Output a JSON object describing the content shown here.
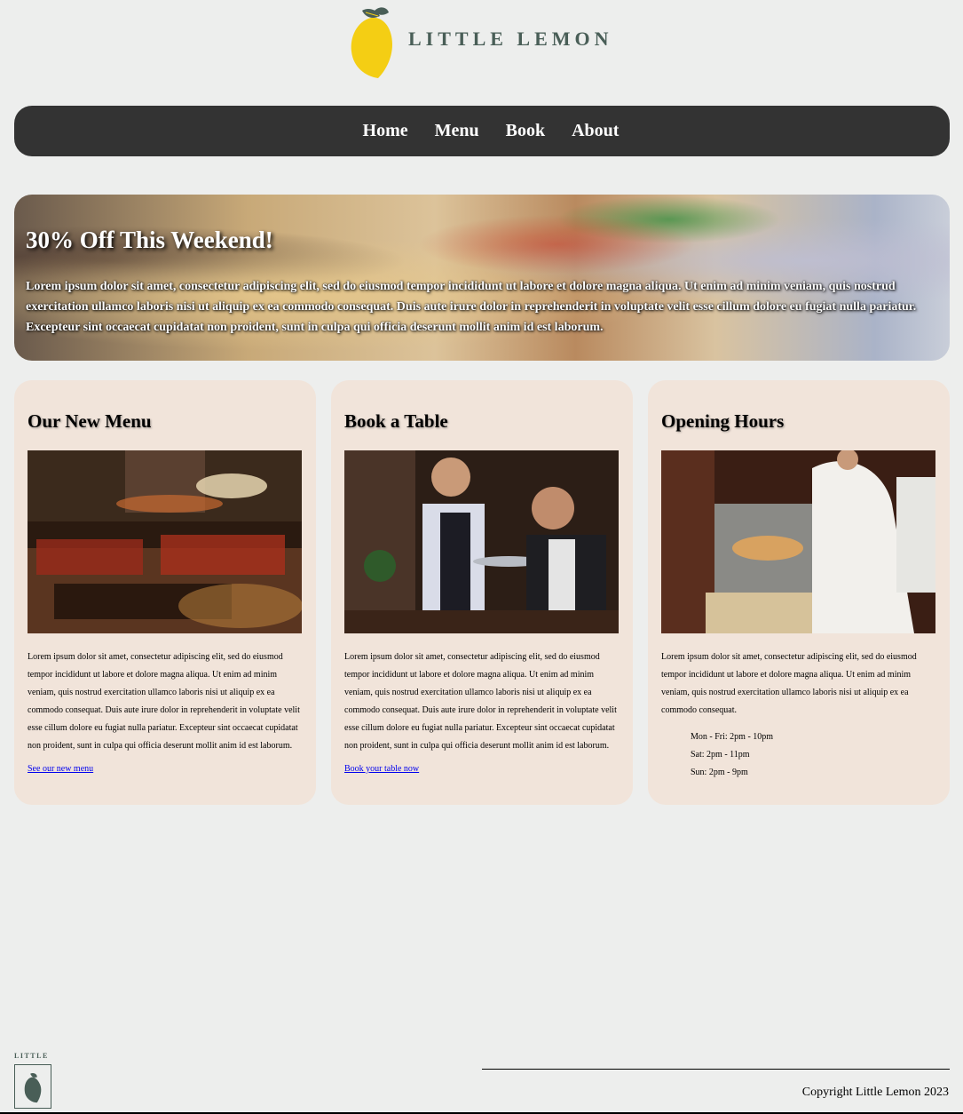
{
  "header": {
    "logo_text": "LITTLE LEMON",
    "logo_icon": "lemon-icon"
  },
  "nav": {
    "items": [
      {
        "label": "Home"
      },
      {
        "label": "Menu"
      },
      {
        "label": "Book"
      },
      {
        "label": "About"
      }
    ]
  },
  "promo": {
    "title": "30% Off This Weekend!",
    "text": "Lorem ipsum dolor sit amet, consectetur adipiscing elit, sed do eiusmod tempor incididunt ut labore et dolore magna aliqua. Ut enim ad minim veniam, quis nostrud exercitation ullamco laboris nisi ut aliquip ex ea commodo consequat. Duis aute irure dolor in reprehenderit in voluptate velit esse cillum dolore eu fugiat nulla pariatur. Excepteur sint occaecat cupidatat non proident, sunt in culpa qui officia deserunt mollit anim id est laborum."
  },
  "cards": [
    {
      "title": "Our New Menu",
      "text": "Lorem ipsum dolor sit amet, consectetur adipiscing elit, sed do eiusmod tempor incididunt ut labore et dolore magna aliqua. Ut enim ad minim veniam, quis nostrud exercitation ullamco laboris nisi ut aliquip ex ea commodo consequat. Duis aute irure dolor in reprehenderit in voluptate velit esse cillum dolore eu fugiat nulla pariatur. Excepteur sint occaecat cupidatat non proident, sunt in culpa qui officia deserunt mollit anim id est laborum.",
      "link": "See our new menu"
    },
    {
      "title": "Book a Table",
      "text": "Lorem ipsum dolor sit amet, consectetur adipiscing elit, sed do eiusmod tempor incididunt ut labore et dolore magna aliqua. Ut enim ad minim veniam, quis nostrud exercitation ullamco laboris nisi ut aliquip ex ea commodo consequat. Duis aute irure dolor in reprehenderit in voluptate velit esse cillum dolore eu fugiat nulla pariatur. Excepteur sint occaecat cupidatat non proident, sunt in culpa qui officia deserunt mollit anim id est laborum.",
      "link": "Book your table now"
    },
    {
      "title": "Opening Hours",
      "text": "Lorem ipsum dolor sit amet, consectetur adipiscing elit, sed do eiusmod tempor incididunt ut labore et dolore magna aliqua. Ut enim ad minim veniam, quis nostrud exercitation ullamco laboris nisi ut aliquip ex ea commodo consequat.",
      "hours": [
        "Mon - Fri: 2pm - 10pm",
        "Sat: 2pm - 11pm",
        "Sun: 2pm - 9pm"
      ]
    }
  ],
  "footer": {
    "logo_text": "LITTLE",
    "copyright": "Copyright Little Lemon 2023"
  },
  "colors": {
    "background": "#edeeed",
    "nav": "#333333",
    "card": "#f1e4da",
    "brand_green": "#495e57",
    "lemon_yellow": "#f4ce14"
  }
}
